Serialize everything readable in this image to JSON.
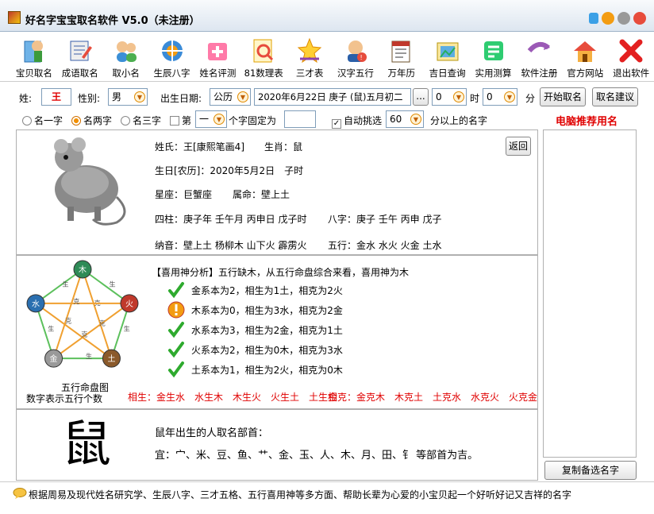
{
  "window": {
    "title": "好名字宝宝取名软件 V5.0（未注册）"
  },
  "toolbar": [
    {
      "label": "宝贝取名",
      "icon": "baby-book-icon"
    },
    {
      "label": "成语取名",
      "icon": "idiom-book-icon"
    },
    {
      "label": "取小名",
      "icon": "nickname-users-icon"
    },
    {
      "label": "生辰八字",
      "icon": "bazi-icon"
    },
    {
      "label": "姓名评测",
      "icon": "name-test-icon"
    },
    {
      "label": "81数理表",
      "icon": "number-table-icon"
    },
    {
      "label": "三才表",
      "icon": "sancai-star-icon"
    },
    {
      "label": "汉字五行",
      "icon": "wuxing-char-icon"
    },
    {
      "label": "万年历",
      "icon": "calendar-icon"
    },
    {
      "label": "吉日查询",
      "icon": "lucky-day-icon"
    },
    {
      "label": "实用测算",
      "icon": "calculation-icon"
    },
    {
      "label": "软件注册",
      "icon": "register-arrow-icon"
    },
    {
      "label": "官方网站",
      "icon": "website-house-icon"
    },
    {
      "label": "退出软件",
      "icon": "exit-x-icon"
    }
  ],
  "form": {
    "surname_label": "姓:",
    "surname": "王",
    "gender_label": "性别:",
    "gender": "男",
    "birth_label": "出生日期:",
    "calendar_type": "公历",
    "birth_date": "2020年6月22日 庚子 (鼠)五月初二",
    "browse": "...",
    "hour": "0",
    "hour_label": "时",
    "minute": "0",
    "minute_label": "分",
    "start_button": "开始取名",
    "suggest_button": "取名建议"
  },
  "options": {
    "one_char": "名一字",
    "two_char": "名两字",
    "three_char": "名三字",
    "fixed_prefix": "第",
    "fixed_pos": "一",
    "fixed_suffix": "个字固定为",
    "fixed_value": "",
    "auto_select": "自动挑选",
    "score": "60",
    "score_suffix": "分以上的名字",
    "auto_check_mark": "✓"
  },
  "recommend_title": "电脑推荐用名",
  "info": {
    "surname": "姓氏：王[康熙笔画4]",
    "zodiac": "生肖：鼠",
    "lunar": "生日[农历]：2020年5月2日　子时",
    "constellation": "星座：巨蟹座",
    "destiny": "属命：壁上土",
    "sizhu": "四柱：庚子年 壬午月 丙申日 戊子时",
    "bazi": "八字：庚子 壬午 丙申 戊子",
    "nayin": "纳音：壁上土 杨柳木 山下火 霹雳火",
    "wuxing": "五行：金水 水火 火金 土水",
    "back_button": "返回"
  },
  "analysis": {
    "title": "【喜用神分析】五行缺木，从五行命盘综合来看，喜用神为木",
    "rows": [
      {
        "text": "金系本为2，相生为1土，相克为2火",
        "status": "ok"
      },
      {
        "text": "木系本为0，相生为3水，相克为2金",
        "status": "warn"
      },
      {
        "text": "水系本为3，相生为2金，相克为1土",
        "status": "ok"
      },
      {
        "text": "火系本为2，相生为0木，相克为3水",
        "status": "ok"
      },
      {
        "text": "土系本为1，相生为2火，相克为0木",
        "status": "ok"
      }
    ],
    "diagram_caption1": "五行命盘图",
    "diagram_caption2": "数字表示五行个数",
    "sheng": "相生：金生水　水生木　木生火　火生土　土生金",
    "ke": "相克：金克木　木克土　土克水　水克火　火克金",
    "nodes": [
      "木",
      "火",
      "土",
      "金",
      "水"
    ],
    "sheng_marks": [
      "生",
      "生",
      "生",
      "生",
      "生"
    ],
    "ke_marks": [
      "克",
      "克",
      "克",
      "克",
      "克"
    ]
  },
  "radical": {
    "char": "鼠",
    "title": "鼠年出生的人取名部首：",
    "good": "宜：宀、米、豆、鱼、艹、金、玉、人、木、月、田、钅 等部首为吉。"
  },
  "copy_button": "复制备选名字",
  "status": "根据周易及现代姓名研究学、生辰八字、三才五格、五行喜用神等多方面、帮助长辈为心爱的小宝贝起一个好听好记又吉祥的名字",
  "colors": {
    "accent_red": "#e00000",
    "check_green": "#2eaa2e",
    "warn_orange": "#f39c12"
  }
}
